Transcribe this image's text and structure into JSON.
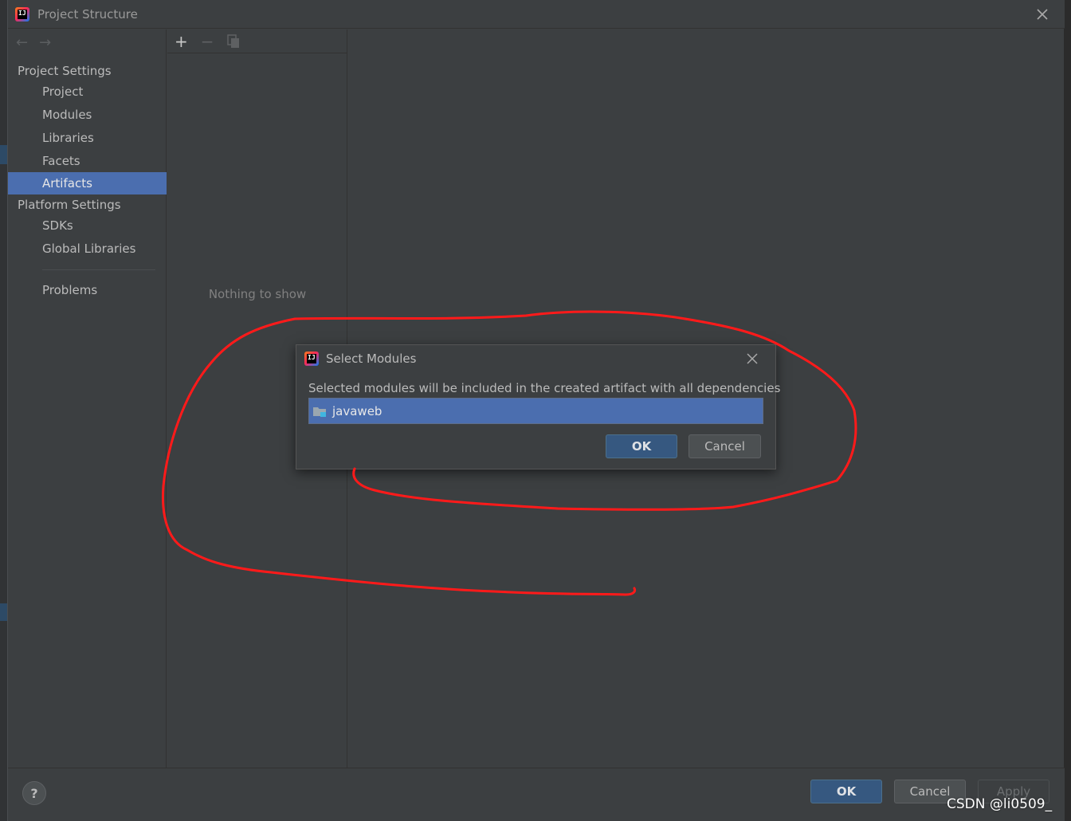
{
  "window": {
    "title": "Project Structure"
  },
  "sidebar": {
    "groups": [
      {
        "label": "Project Settings"
      },
      {
        "label": "Platform Settings"
      }
    ],
    "items": [
      {
        "label": "Project"
      },
      {
        "label": "Modules"
      },
      {
        "label": "Libraries"
      },
      {
        "label": "Facets"
      },
      {
        "label": "Artifacts",
        "selected": true
      },
      {
        "label": "SDKs"
      },
      {
        "label": "Global Libraries"
      },
      {
        "label": "Problems"
      }
    ]
  },
  "list_panel": {
    "empty_text": "Nothing to show"
  },
  "footer": {
    "help_label": "?",
    "ok_label": "OK",
    "cancel_label": "Cancel",
    "apply_label": "Apply"
  },
  "modal": {
    "title": "Select Modules",
    "description": "Selected modules will be included in the created artifact with all dependencies",
    "modules": [
      {
        "name": "javaweb",
        "selected": true
      }
    ],
    "ok_label": "OK",
    "cancel_label": "Cancel"
  },
  "watermark": "CSDN @li0509_",
  "colors": {
    "selection": "#4b6eaf",
    "primary_button": "#365880",
    "annotation": "#ff1a1a"
  }
}
